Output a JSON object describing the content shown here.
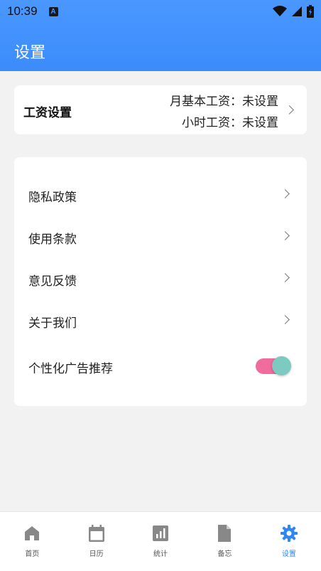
{
  "status_bar": {
    "time": "10:39",
    "notification_icon": "A"
  },
  "header": {
    "title": "设置"
  },
  "salary": {
    "title": "工资设置",
    "monthly": "月基本工资：未设置",
    "hourly": "小时工资：未设置"
  },
  "settings": {
    "items": [
      {
        "label": "隐私政策"
      },
      {
        "label": "使用条款"
      },
      {
        "label": "意见反馈"
      },
      {
        "label": "关于我们"
      }
    ],
    "ad_toggle": {
      "label": "个性化广告推荐",
      "enabled": true
    }
  },
  "tabbar": {
    "tabs": [
      {
        "label": "首页",
        "icon": "home-icon"
      },
      {
        "label": "日历",
        "icon": "calendar-icon"
      },
      {
        "label": "统计",
        "icon": "chart-icon"
      },
      {
        "label": "备忘",
        "icon": "note-icon"
      },
      {
        "label": "设置",
        "icon": "gear-icon",
        "active": true
      }
    ]
  },
  "colors": {
    "accent": "#2f86f6",
    "header": "#4a97ff",
    "toggle_track": "#ef6c9c",
    "toggle_knob": "#7dcac0"
  }
}
